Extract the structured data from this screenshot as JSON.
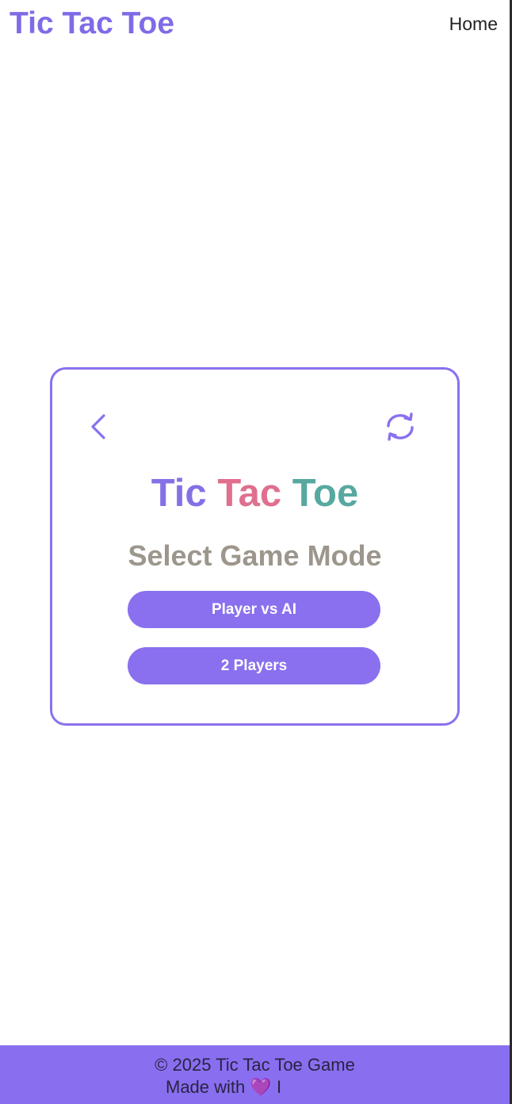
{
  "header": {
    "brand": "Tic Tac Toe",
    "nav_home": "Home"
  },
  "card": {
    "back_icon": "chevron-left-icon",
    "reset_icon": "refresh-icon",
    "title": {
      "part1": "Tic",
      "part2": "Tac",
      "part3": "Toe"
    },
    "subtitle": "Select Game Mode",
    "mode_buttons": [
      {
        "label": "Player vs AI"
      },
      {
        "label": "2 Players"
      }
    ]
  },
  "footer": {
    "copyright": "© 2025 Tic Tac Toe Game",
    "made_with_prefix": "Made with",
    "heart": "💜",
    "made_with_suffix": "I"
  },
  "colors": {
    "accent": "#8a70ee",
    "title_tic": "#8570e6",
    "title_tac": "#e06f8e",
    "title_toe": "#57a9a0",
    "subtitle": "#9c968c"
  }
}
